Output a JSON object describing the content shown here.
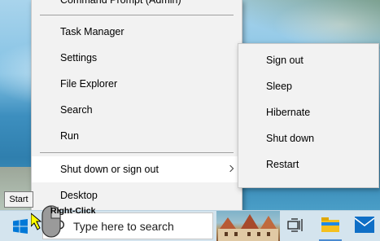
{
  "menu": {
    "partial_top_item": "Command Prompt (Admin)",
    "items": [
      {
        "label": "Task Manager"
      },
      {
        "label": "Settings"
      },
      {
        "label": "File Explorer"
      },
      {
        "label": "Search"
      },
      {
        "label": "Run"
      },
      {
        "label": "Shut down or sign out"
      },
      {
        "label": "Desktop"
      }
    ]
  },
  "submenu": {
    "items": [
      {
        "label": "Sign out"
      },
      {
        "label": "Sleep"
      },
      {
        "label": "Hibernate"
      },
      {
        "label": "Shut down"
      },
      {
        "label": "Restart"
      }
    ]
  },
  "tooltip": {
    "text": "Start"
  },
  "overlay": {
    "mouse_label": "Right-Click"
  },
  "taskbar": {
    "search_placeholder": "Type here to search",
    "icons": [
      "windows-logo-icon",
      "search-icon",
      "task-view-icon",
      "file-explorer-icon",
      "mail-icon"
    ]
  },
  "colors": {
    "menu_bg": "#f2f2f2",
    "menu_highlight": "#ffffff",
    "taskbar_bg": "#d4e4ee",
    "windows_blue": "#0078d7",
    "explorer_yellow": "#f4c01e"
  }
}
